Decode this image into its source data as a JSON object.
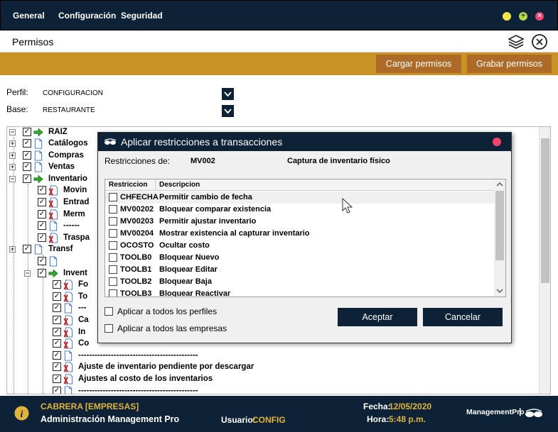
{
  "menu": {
    "items": [
      "General",
      "Configuración",
      "Seguridad"
    ]
  },
  "window": {
    "controls": [
      "minimize-button",
      "maximize-button",
      "close-button"
    ]
  },
  "header": {
    "title": "Permisos",
    "icons": [
      "layers-icon",
      "close-circle-icon"
    ]
  },
  "actions": {
    "load_label": "Cargar permisos",
    "save_label": "Grabar permisos"
  },
  "form": {
    "perfil_label": "Perfil:",
    "perfil_value": "CONFIGURACION",
    "base_label": "Base:",
    "base_value": "RESTAURANTE"
  },
  "tree": {
    "root": "RAIZ",
    "nodes": [
      {
        "label": "Catálogos"
      },
      {
        "label": "Compras"
      },
      {
        "label": "Ventas"
      },
      {
        "label": "Inventario"
      },
      {
        "label": "Movin"
      },
      {
        "label": "Entrad"
      },
      {
        "label": "Merm"
      },
      {
        "label": "------"
      },
      {
        "label": "Traspa"
      },
      {
        "label": "Transf"
      },
      {
        "label": ""
      },
      {
        "label": "Invent"
      },
      {
        "label": "Fo"
      },
      {
        "label": "To"
      },
      {
        "label": "---"
      },
      {
        "label": "Ca"
      },
      {
        "label": "In"
      },
      {
        "label": "Co"
      },
      {
        "label": "--------------------------------------------"
      },
      {
        "label": "Ajuste de inventario pendiente por descargar"
      },
      {
        "label": "Ajustes al costo de los inventarios"
      },
      {
        "label": "--------------------------------------------"
      }
    ]
  },
  "modal": {
    "title": "Aplicar restricciones a transacciones",
    "restr_label": "Restricciones de:",
    "restr_code": "MV002",
    "restr_desc": "Captura de inventario físico",
    "col_code": "Restriccion",
    "col_desc": "Descripcion",
    "rows": [
      {
        "code": "CHFECHA",
        "desc": "Permitir  cambio de fecha"
      },
      {
        "code": "MV00202",
        "desc": "Bloquear comparar existencia"
      },
      {
        "code": "MV00203",
        "desc": "Permitir ajustar inventario"
      },
      {
        "code": "MV00204",
        "desc": "Mostrar existencia al capturar inventario"
      },
      {
        "code": "OCOSTO",
        "desc": "Ocultar  costo"
      },
      {
        "code": "TOOLB0",
        "desc": "Bloquear Nuevo"
      },
      {
        "code": "TOOLB1",
        "desc": "Bloquear Editar"
      },
      {
        "code": "TOOLB2",
        "desc": "Bloquear Baja"
      },
      {
        "code": "TOOLB3",
        "desc": "Bloquear Reactivar"
      }
    ],
    "check_all_profiles": "Aplicar a todos los perfiles",
    "check_all_companies": "Aplicar a todos las empresas",
    "accept": "Aceptar",
    "cancel": "Cancelar"
  },
  "footer": {
    "company": "CABRERA [EMPRESAS]",
    "app": "Administración Management Pro",
    "user_label": "Usuario:",
    "user": "CONFIG",
    "date_label": "Fecha:",
    "date": "12/05/2020",
    "time_label": "Hora:",
    "time": "5:48 p.m.",
    "brand": "ManagementPro",
    "brand_sep": "|"
  },
  "colors": {
    "navy": "#0d2236",
    "gold_bar": "#c89226",
    "button_brown": "#ad6b27",
    "footer_gold": "#e0b43c"
  }
}
